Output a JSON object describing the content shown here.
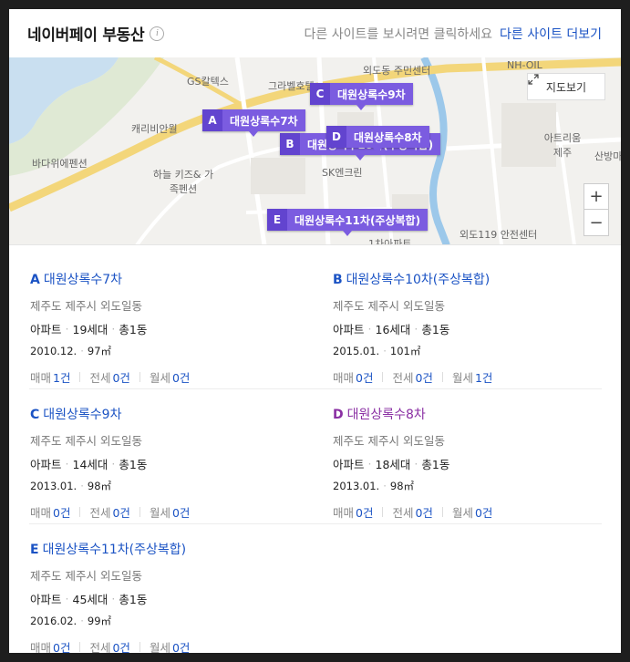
{
  "header": {
    "title": "네이버페이 부동산",
    "info": "i",
    "hint": "다른 사이트를 보시려면 클릭하세요",
    "more_link": "다른 사이트 더보기"
  },
  "map": {
    "view_button": "지도보기",
    "zoom_in": "+",
    "zoom_out": "−",
    "labels": [
      "GS칼텍스",
      "그라벨호텔",
      "외도동 주민센터",
      "NH-OIL",
      "캐리비안월",
      "바다위에펜션",
      "하늘 키즈& 가족펜션",
      "SK엔크린",
      "아트리움 제주",
      "외도119 안전센터",
      "산방마",
      "1차아파트"
    ],
    "pins": [
      {
        "letter": "A",
        "name": "대원상록수7차"
      },
      {
        "letter": "B",
        "name": "대원상록수10차(주상복합)"
      },
      {
        "letter": "C",
        "name": "대원상록수9차"
      },
      {
        "letter": "D",
        "name": "대원상록수8차"
      },
      {
        "letter": "E",
        "name": "대원상록수11차(주상복합)"
      }
    ]
  },
  "items": [
    {
      "letter": "A",
      "name": "대원상록수7차",
      "address": "제주도 제주시 외도일동",
      "type": "아파트",
      "households": "19세대",
      "buildings": "총1동",
      "date": "2010.12.",
      "area": "97㎡",
      "sale_label": "매매",
      "sale": "1건",
      "jeonse_label": "전세",
      "jeonse": "0건",
      "monthly_label": "월세",
      "monthly": "0건"
    },
    {
      "letter": "B",
      "name": "대원상록수10차(주상복합)",
      "address": "제주도 제주시 외도일동",
      "type": "아파트",
      "households": "16세대",
      "buildings": "총1동",
      "date": "2015.01.",
      "area": "101㎡",
      "sale_label": "매매",
      "sale": "0건",
      "jeonse_label": "전세",
      "jeonse": "0건",
      "monthly_label": "월세",
      "monthly": "1건"
    },
    {
      "letter": "C",
      "name": "대원상록수9차",
      "address": "제주도 제주시 외도일동",
      "type": "아파트",
      "households": "14세대",
      "buildings": "총1동",
      "date": "2013.01.",
      "area": "98㎡",
      "sale_label": "매매",
      "sale": "0건",
      "jeonse_label": "전세",
      "jeonse": "0건",
      "monthly_label": "월세",
      "monthly": "0건"
    },
    {
      "letter": "D",
      "name": "대원상록수8차",
      "address": "제주도 제주시 외도일동",
      "type": "아파트",
      "households": "18세대",
      "buildings": "총1동",
      "date": "2013.01.",
      "area": "98㎡",
      "sale_label": "매매",
      "sale": "0건",
      "jeonse_label": "전세",
      "jeonse": "0건",
      "monthly_label": "월세",
      "monthly": "0건"
    },
    {
      "letter": "E",
      "name": "대원상록수11차(주상복합)",
      "address": "제주도 제주시 외도일동",
      "type": "아파트",
      "households": "45세대",
      "buildings": "총1동",
      "date": "2016.02.",
      "area": "99㎡",
      "sale_label": "매매",
      "sale": "0건",
      "jeonse_label": "전세",
      "jeonse": "0건",
      "monthly_label": "월세",
      "monthly": "0건"
    }
  ],
  "colors": {
    "link": "#1b53c4",
    "visited": "#8a2fa3",
    "pin": "#7b5ce0",
    "pin_letter": "#6244cf"
  }
}
